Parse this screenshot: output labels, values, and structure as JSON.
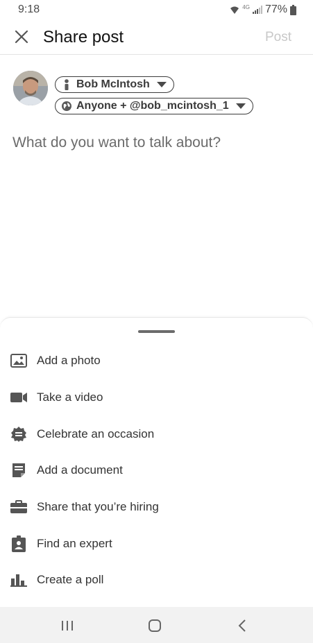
{
  "status_bar": {
    "time": "9:18",
    "network": "4G",
    "battery": "77%",
    "icons": [
      "wifi-icon",
      "signal-icon",
      "battery-icon"
    ]
  },
  "header": {
    "title": "Share post",
    "post_label": "Post",
    "close_icon": "close-icon"
  },
  "author": {
    "name": "Bob McIntosh",
    "audience": "Anyone + @bob_mcintosh_1"
  },
  "composer": {
    "placeholder": "What do you want to talk about?"
  },
  "actions": [
    {
      "label": "Add a photo",
      "icon": "photo-icon"
    },
    {
      "label": "Take a video",
      "icon": "video-camera-icon"
    },
    {
      "label": "Celebrate an occasion",
      "icon": "celebrate-badge-icon"
    },
    {
      "label": "Add a document",
      "icon": "document-icon"
    },
    {
      "label": "Share that you’re hiring",
      "icon": "briefcase-icon"
    },
    {
      "label": "Find an expert",
      "icon": "id-badge-icon"
    },
    {
      "label": "Create a poll",
      "icon": "poll-chart-icon"
    }
  ],
  "colors": {
    "post_disabled": "#c8c8c8",
    "icon_gray": "#555555",
    "nav_bg": "#f2f2f2"
  }
}
